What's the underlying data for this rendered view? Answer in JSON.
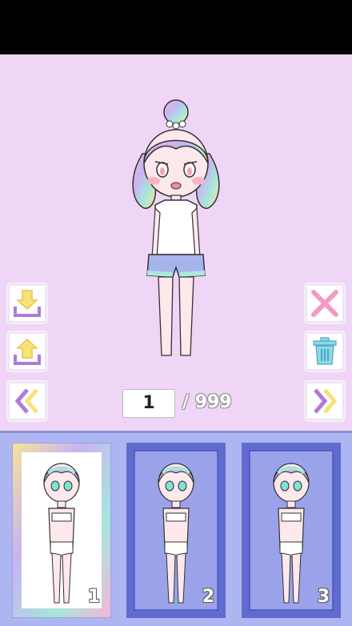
{
  "toolbar": {
    "save_icon": "download-to-tray-icon",
    "load_icon": "upload-from-tray-icon",
    "prev_icon": "double-chevron-left-icon",
    "close_icon": "close-x-icon",
    "delete_icon": "trash-can-icon",
    "next_icon": "double-chevron-right-icon"
  },
  "pager": {
    "current": "1",
    "total": "/ 999"
  },
  "slots": [
    {
      "number": "1",
      "selected": true
    },
    {
      "number": "2",
      "selected": false
    },
    {
      "number": "3",
      "selected": false
    }
  ],
  "colors": {
    "stage_bg": "#f0d6f6",
    "tray_bg": "#aeb6f2",
    "slot_blue": "#5f6bd0",
    "accent_yellow": "#f7e27a",
    "accent_purple": "#b07ad8",
    "accent_pink": "#f39ac4",
    "accent_cyan": "#8fd8e8"
  }
}
